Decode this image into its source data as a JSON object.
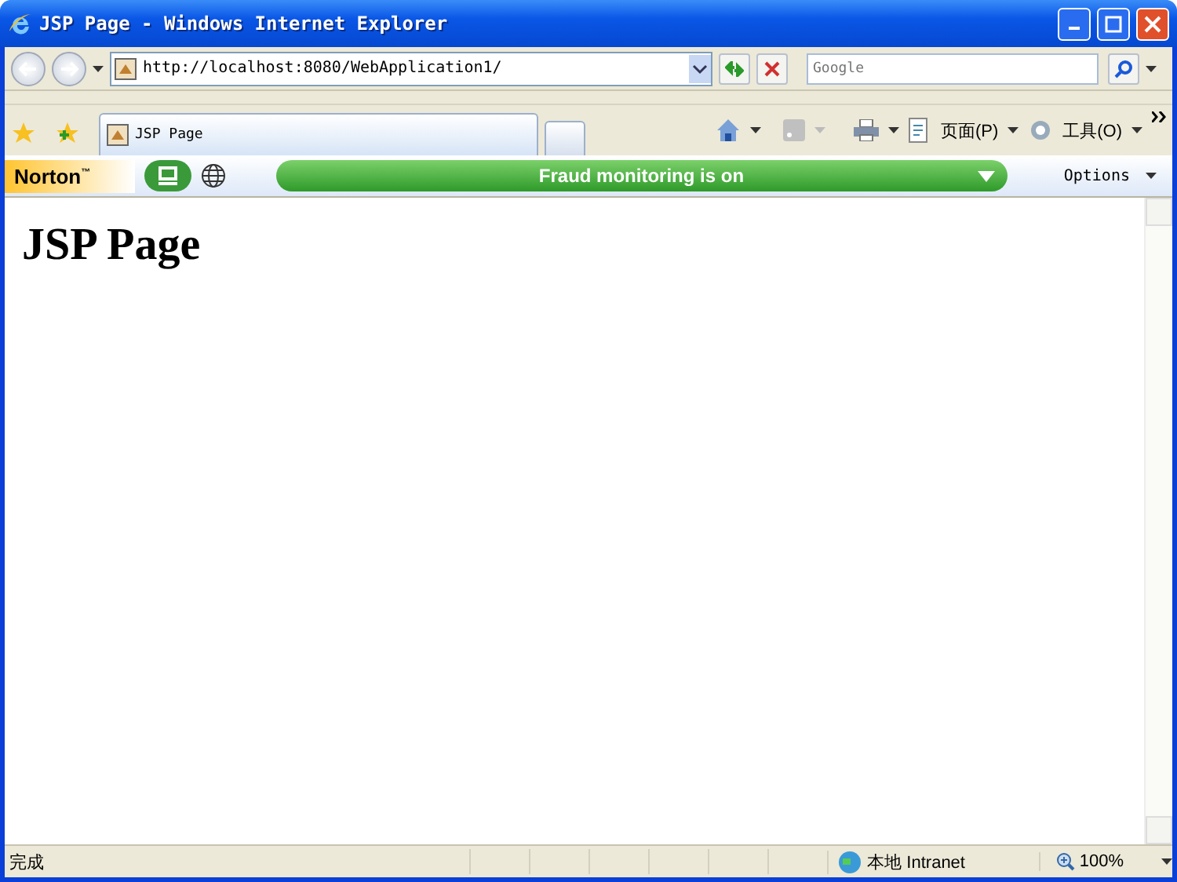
{
  "window": {
    "title": "JSP Page - Windows Internet Explorer"
  },
  "address_bar": {
    "url": "http://localhost:8080/WebApplication1/"
  },
  "search": {
    "placeholder": "Google"
  },
  "tabs": [
    {
      "label": "JSP Page",
      "selected": true
    }
  ],
  "command_bar": {
    "page_menu": "页面(P)",
    "tools_menu": "工具(O)"
  },
  "norton": {
    "brand": "Norton",
    "trademark": "™",
    "status": "Fraud monitoring is on",
    "options": "Options"
  },
  "page": {
    "heading": "JSP Page"
  },
  "status_bar": {
    "text": "完成",
    "zone": "本地 Intranet",
    "zoom": "100%"
  }
}
